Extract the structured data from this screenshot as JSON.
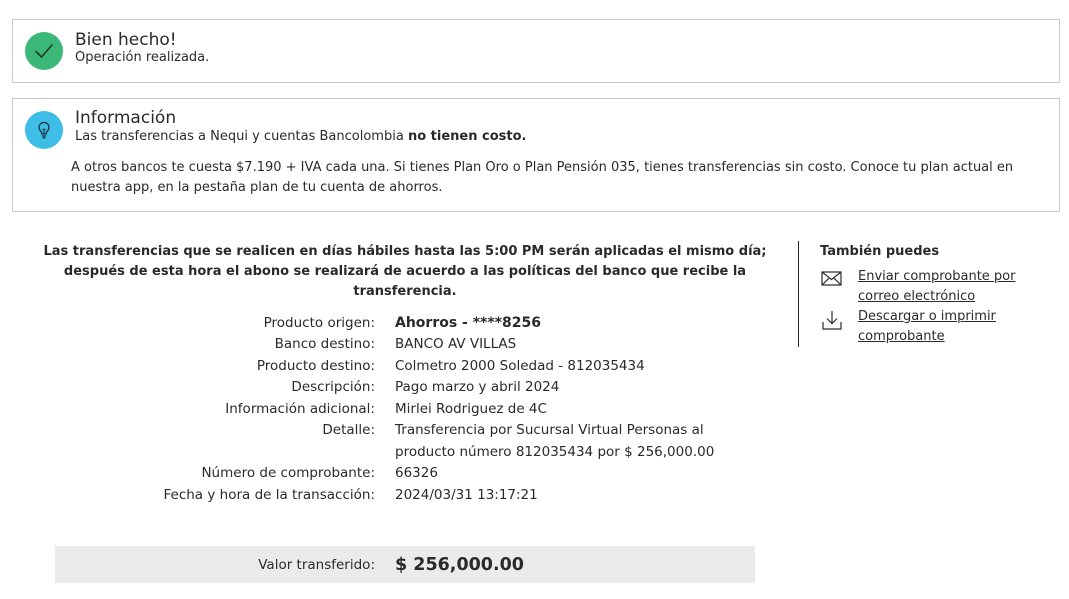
{
  "success": {
    "title": "Bien hecho!",
    "subtitle": "Operación realizada.",
    "icon": "check-icon",
    "color": "#3bb877"
  },
  "info": {
    "title": "Información",
    "line_prefix": "Las transferencias a Nequi y cuentas Bancolombia ",
    "line_bold": "no tienen costo.",
    "paragraph": "A otros bancos te cuesta $7.190 + IVA cada una. Si tienes Plan Oro o Plan Pensión 035, tienes transferencias sin costo. Conoce tu plan actual en nuestra app, en la pestaña plan de tu cuenta de ahorros.",
    "icon": "lightbulb-icon",
    "color": "#3ebee6"
  },
  "notice": "Las transferencias que se realicen en días hábiles hasta las 5:00 PM serán aplicadas el mismo día; después de esta hora el abono se realizará de acuerdo a las políticas del banco que recibe la transferencia.",
  "sidebar": {
    "title": "También puedes",
    "links": [
      {
        "label": "Enviar comprobante por correo electrónico",
        "icon": "envelope-icon"
      },
      {
        "label": "Descargar o imprimir comprobante",
        "icon": "download-icon"
      }
    ]
  },
  "details": {
    "rows": [
      {
        "label": "Producto origen:",
        "value": "Ahorros - ****8256"
      },
      {
        "label": "Banco destino:",
        "value": "BANCO AV VILLAS"
      },
      {
        "label": "Producto destino:",
        "value": "Colmetro 2000 Soledad - 812035434"
      },
      {
        "label": "Descripción:",
        "value": "Pago marzo y abril 2024"
      },
      {
        "label": "Información adicional:",
        "value": "Mirlei Rodriguez de 4C"
      },
      {
        "label": "Detalle:",
        "value": "Transferencia por Sucursal Virtual Personas al producto número 812035434 por $ 256,000.00"
      },
      {
        "label": "Número de comprobante:",
        "value": "66326"
      },
      {
        "label": "Fecha y hora de la transacción:",
        "value": "2024/03/31 13:17:21"
      }
    ]
  },
  "total": {
    "label": "Valor transferido:",
    "value": "$ 256,000.00"
  }
}
